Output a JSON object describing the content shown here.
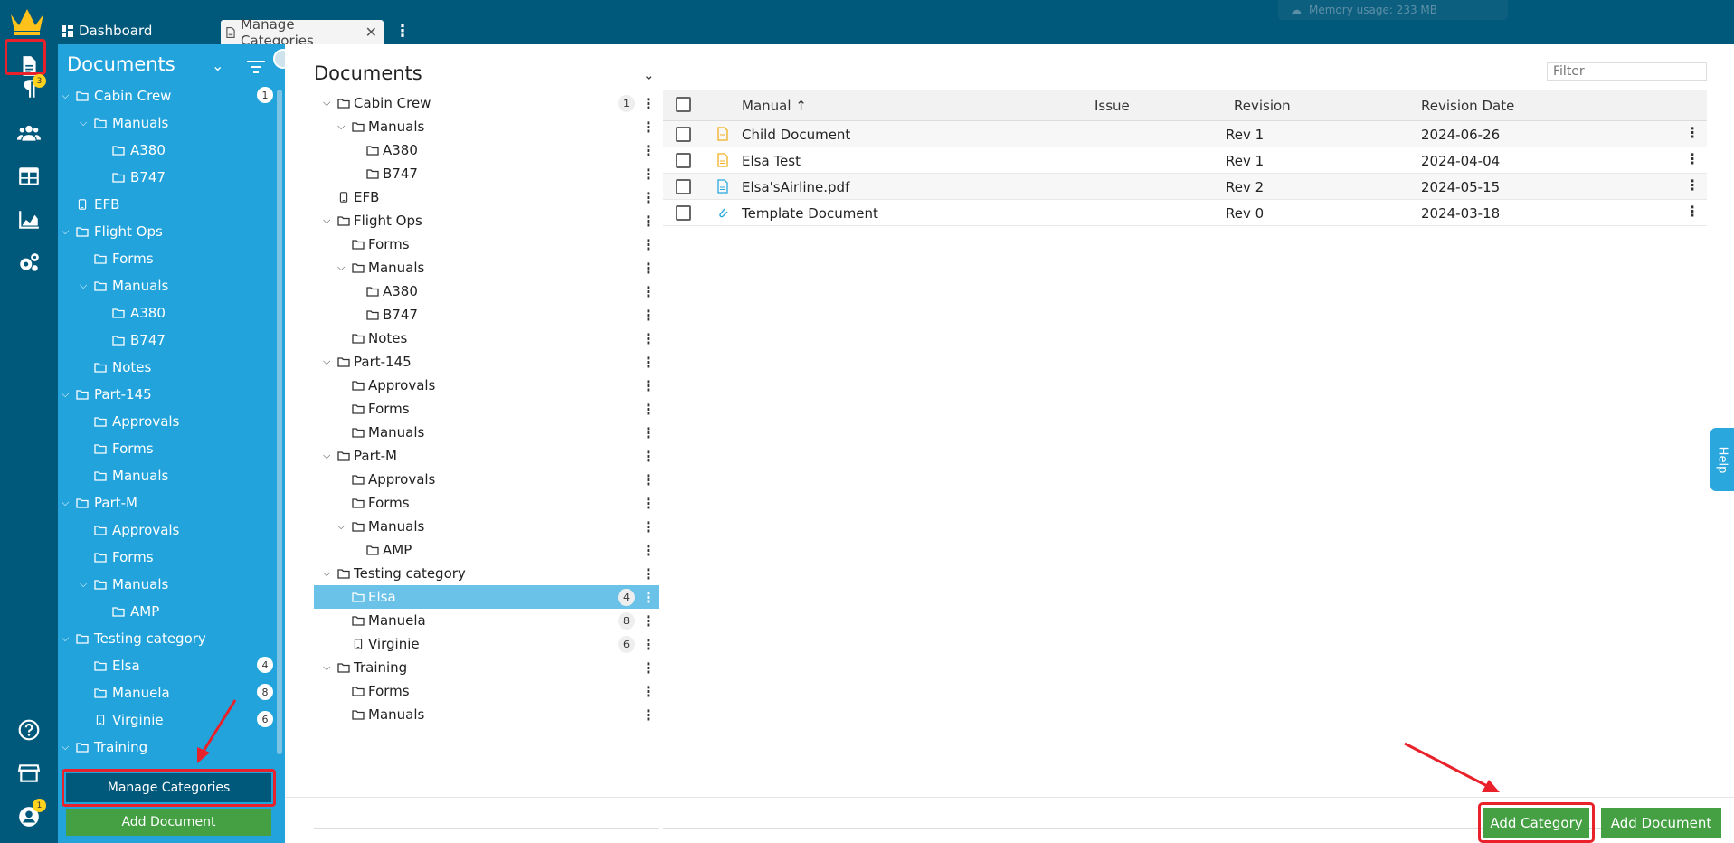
{
  "topbar": {
    "tab_dashboard": "Dashboard",
    "tab_manage": "Manage Categories",
    "memory_usage": "Memory usage: 233 MB"
  },
  "rail": {
    "documents_badge": "",
    "messages_badge": "3",
    "profile_badge": "1"
  },
  "sidebar": {
    "title": "Documents",
    "items": [
      {
        "label": "Cabin Crew",
        "level": 0,
        "chevron": true,
        "icon": "folder",
        "badge": "1"
      },
      {
        "label": "Manuals",
        "level": 1,
        "chevron": true,
        "icon": "folder",
        "badge": ""
      },
      {
        "label": "A380",
        "level": 2,
        "chevron": false,
        "icon": "folder",
        "badge": ""
      },
      {
        "label": "B747",
        "level": 2,
        "chevron": false,
        "icon": "folder",
        "badge": ""
      },
      {
        "label": "EFB",
        "level": 0,
        "chevron": false,
        "icon": "tablet",
        "badge": ""
      },
      {
        "label": "Flight Ops",
        "level": 0,
        "chevron": true,
        "icon": "folder",
        "badge": ""
      },
      {
        "label": "Forms",
        "level": 1,
        "chevron": false,
        "icon": "folder",
        "badge": ""
      },
      {
        "label": "Manuals",
        "level": 1,
        "chevron": true,
        "icon": "folder",
        "badge": ""
      },
      {
        "label": "A380",
        "level": 2,
        "chevron": false,
        "icon": "folder",
        "badge": ""
      },
      {
        "label": "B747",
        "level": 2,
        "chevron": false,
        "icon": "folder",
        "badge": ""
      },
      {
        "label": "Notes",
        "level": 1,
        "chevron": false,
        "icon": "folder",
        "badge": ""
      },
      {
        "label": "Part-145",
        "level": 0,
        "chevron": true,
        "icon": "folder",
        "badge": ""
      },
      {
        "label": "Approvals",
        "level": 1,
        "chevron": false,
        "icon": "folder",
        "badge": ""
      },
      {
        "label": "Forms",
        "level": 1,
        "chevron": false,
        "icon": "folder",
        "badge": ""
      },
      {
        "label": "Manuals",
        "level": 1,
        "chevron": false,
        "icon": "folder",
        "badge": ""
      },
      {
        "label": "Part-M",
        "level": 0,
        "chevron": true,
        "icon": "folder",
        "badge": ""
      },
      {
        "label": "Approvals",
        "level": 1,
        "chevron": false,
        "icon": "folder",
        "badge": ""
      },
      {
        "label": "Forms",
        "level": 1,
        "chevron": false,
        "icon": "folder",
        "badge": ""
      },
      {
        "label": "Manuals",
        "level": 1,
        "chevron": true,
        "icon": "folder",
        "badge": ""
      },
      {
        "label": "AMP",
        "level": 2,
        "chevron": false,
        "icon": "folder",
        "badge": ""
      },
      {
        "label": "Testing category",
        "level": 0,
        "chevron": true,
        "icon": "folder",
        "badge": ""
      },
      {
        "label": "Elsa",
        "level": 1,
        "chevron": false,
        "icon": "folder",
        "badge": "4"
      },
      {
        "label": "Manuela",
        "level": 1,
        "chevron": false,
        "icon": "folder",
        "badge": "8"
      },
      {
        "label": "Virginie",
        "level": 1,
        "chevron": false,
        "icon": "tablet",
        "badge": "6"
      },
      {
        "label": "Training",
        "level": 0,
        "chevron": true,
        "icon": "folder",
        "badge": ""
      }
    ],
    "manage_categories_label": "Manage Categories",
    "add_document_label": "Add Document"
  },
  "main": {
    "title": "Documents",
    "filter_placeholder": "Filter",
    "tree": [
      {
        "label": "Cabin Crew",
        "level": 0,
        "chevron": true,
        "icon": "folder",
        "badge": "1",
        "selected": false
      },
      {
        "label": "Manuals",
        "level": 1,
        "chevron": true,
        "icon": "folder",
        "badge": "",
        "selected": false
      },
      {
        "label": "A380",
        "level": 2,
        "chevron": false,
        "icon": "folder",
        "badge": "",
        "selected": false
      },
      {
        "label": "B747",
        "level": 2,
        "chevron": false,
        "icon": "folder",
        "badge": "",
        "selected": false
      },
      {
        "label": "EFB",
        "level": 0,
        "chevron": false,
        "icon": "tablet",
        "badge": "",
        "selected": false
      },
      {
        "label": "Flight Ops",
        "level": 0,
        "chevron": true,
        "icon": "folder",
        "badge": "",
        "selected": false
      },
      {
        "label": "Forms",
        "level": 1,
        "chevron": false,
        "icon": "folder",
        "badge": "",
        "selected": false
      },
      {
        "label": "Manuals",
        "level": 1,
        "chevron": true,
        "icon": "folder",
        "badge": "",
        "selected": false
      },
      {
        "label": "A380",
        "level": 2,
        "chevron": false,
        "icon": "folder",
        "badge": "",
        "selected": false
      },
      {
        "label": "B747",
        "level": 2,
        "chevron": false,
        "icon": "folder",
        "badge": "",
        "selected": false
      },
      {
        "label": "Notes",
        "level": 1,
        "chevron": false,
        "icon": "folder",
        "badge": "",
        "selected": false
      },
      {
        "label": "Part-145",
        "level": 0,
        "chevron": true,
        "icon": "folder",
        "badge": "",
        "selected": false
      },
      {
        "label": "Approvals",
        "level": 1,
        "chevron": false,
        "icon": "folder",
        "badge": "",
        "selected": false
      },
      {
        "label": "Forms",
        "level": 1,
        "chevron": false,
        "icon": "folder",
        "badge": "",
        "selected": false
      },
      {
        "label": "Manuals",
        "level": 1,
        "chevron": false,
        "icon": "folder",
        "badge": "",
        "selected": false
      },
      {
        "label": "Part-M",
        "level": 0,
        "chevron": true,
        "icon": "folder",
        "badge": "",
        "selected": false
      },
      {
        "label": "Approvals",
        "level": 1,
        "chevron": false,
        "icon": "folder",
        "badge": "",
        "selected": false
      },
      {
        "label": "Forms",
        "level": 1,
        "chevron": false,
        "icon": "folder",
        "badge": "",
        "selected": false
      },
      {
        "label": "Manuals",
        "level": 1,
        "chevron": true,
        "icon": "folder",
        "badge": "",
        "selected": false
      },
      {
        "label": "AMP",
        "level": 2,
        "chevron": false,
        "icon": "folder",
        "badge": "",
        "selected": false
      },
      {
        "label": "Testing category",
        "level": 0,
        "chevron": true,
        "icon": "folder",
        "badge": "",
        "selected": false
      },
      {
        "label": "Elsa",
        "level": 1,
        "chevron": false,
        "icon": "folder",
        "badge": "4",
        "selected": true
      },
      {
        "label": "Manuela",
        "level": 1,
        "chevron": false,
        "icon": "folder",
        "badge": "8",
        "selected": false
      },
      {
        "label": "Virginie",
        "level": 1,
        "chevron": false,
        "icon": "tablet",
        "badge": "6",
        "selected": false
      },
      {
        "label": "Training",
        "level": 0,
        "chevron": true,
        "icon": "folder",
        "badge": "",
        "selected": false
      },
      {
        "label": "Forms",
        "level": 1,
        "chevron": false,
        "icon": "folder",
        "badge": "",
        "selected": false
      },
      {
        "label": "Manuals",
        "level": 1,
        "chevron": false,
        "icon": "folder",
        "badge": "",
        "selected": false
      }
    ],
    "table": {
      "columns": [
        "Manual",
        "Issue",
        "Revision",
        "Revision Date"
      ],
      "sort_indicator": "↑",
      "rows": [
        {
          "icon": "document-yellow-icon",
          "manual": "Child Document",
          "issue": "",
          "revision": "Rev 1",
          "date": "2024-06-26"
        },
        {
          "icon": "document-yellow-icon",
          "manual": "Elsa Test",
          "issue": "",
          "revision": "Rev 1",
          "date": "2024-04-04"
        },
        {
          "icon": "document-blue-icon",
          "manual": "Elsa'sAirline.pdf",
          "issue": "",
          "revision": "Rev 2",
          "date": "2024-05-15"
        },
        {
          "icon": "paperclip-icon",
          "manual": "Template Document",
          "issue": "",
          "revision": "Rev 0",
          "date": "2024-03-18"
        }
      ]
    },
    "add_category_label": "Add Category",
    "add_document_label": "Add Document",
    "help_label": "Help"
  },
  "colors": {
    "topbar": "#00587a",
    "sidebar": "#22a3db",
    "selected_row": "#6bc2e8",
    "button_green": "#44a043",
    "highlight_red": "#e8212b"
  }
}
